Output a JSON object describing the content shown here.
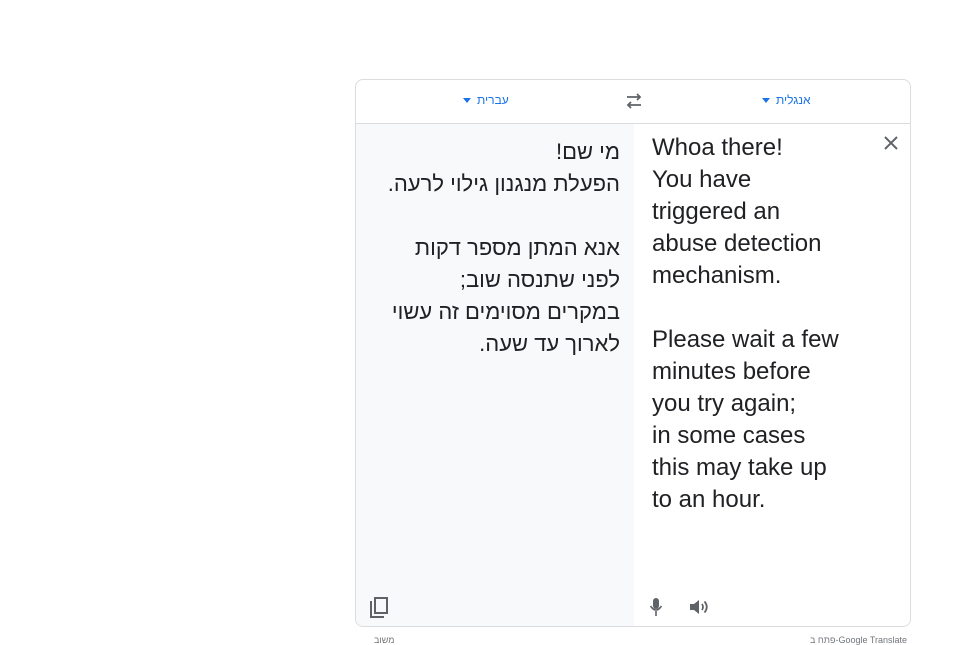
{
  "header": {
    "source_language": "עברית",
    "target_language": "אנגלית"
  },
  "source": {
    "text": "מי שם!\nהפעלת מנגנון גילוי לרעה.\n\nאנא המתן מספר דקות\nלפני שתנסה שוב;\nבמקרים מסוימים זה עשוי\nלארוך עד שעה."
  },
  "translation": {
    "text": "Whoa there!\nYou have\ntriggered an\nabuse detection\nmechanism.\n\nPlease wait a few\nminutes before\nyou try again;\nin some cases\nthis may take up\nto an hour."
  },
  "footer": {
    "left_label": "משוב",
    "right_label": "פתח ב-Google Translate"
  },
  "colors": {
    "accent": "#1a73e8",
    "icon": "#5f6368",
    "source_pane_bg": "#f8f9fa",
    "border": "#dadce0"
  },
  "icons": [
    "swap-languages-icon",
    "close-icon",
    "copy-icon",
    "microphone-icon",
    "speaker-icon"
  ]
}
